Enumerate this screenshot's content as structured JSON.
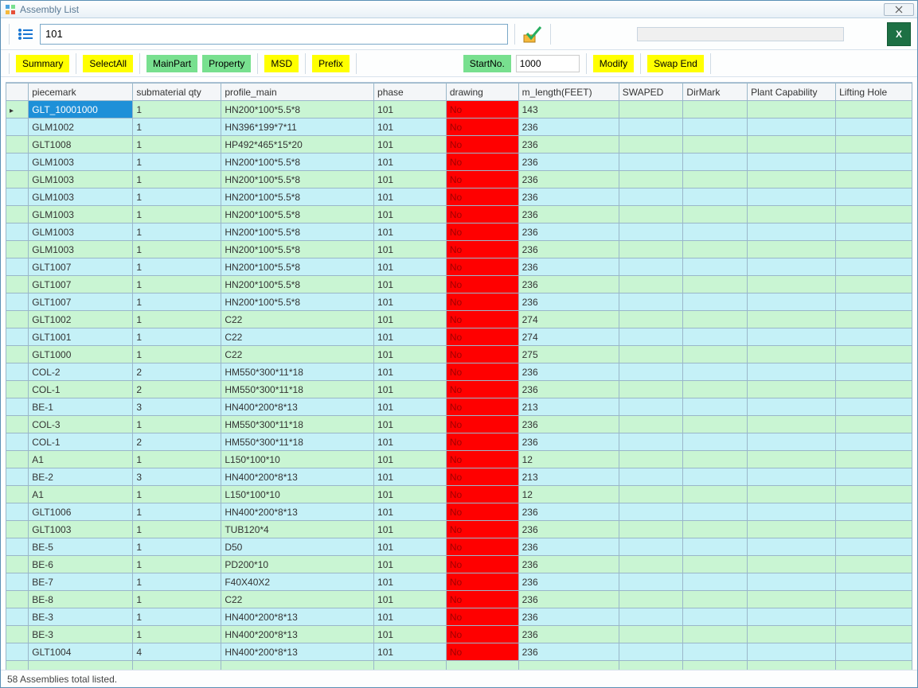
{
  "window": {
    "title": "Assembly List"
  },
  "toolbar1": {
    "search_value": "101",
    "progress_value": ""
  },
  "toolbar2": {
    "summary": "Summary",
    "selectall": "SelectAll",
    "mainpart": "MainPart",
    "property": "Property",
    "msd": "MSD",
    "prefix": "Prefix",
    "startno_label": "StartNo.",
    "startno_value": "1000",
    "modify": "Modify",
    "swapend": "Swap End"
  },
  "columns": {
    "piecemark": "piecemark",
    "submaterial_qty": "submaterial qty",
    "profile_main": "profile_main",
    "phase": "phase",
    "drawing": "drawing",
    "m_length": "m_length(FEET)",
    "swaped": "SWAPED",
    "dirmark": "DirMark",
    "plant_capability": "Plant Capability",
    "lifting_hole": "Lifting Hole"
  },
  "colwidths": {
    "rowhdr": 28,
    "piecemark": 130,
    "submaterial_qty": 110,
    "profile_main": 190,
    "phase": 90,
    "drawing": 90,
    "m_length": 125,
    "swaped": 80,
    "dirmark": 80,
    "plant_capability": 110,
    "lifting_hole": 95
  },
  "rows": [
    {
      "piecemark": "GLT_10001000",
      "qty": "1",
      "profile": "HN200*100*5.5*8",
      "phase": "101",
      "drawing": "No",
      "mlen": "143",
      "selected": true
    },
    {
      "piecemark": "GLM1002",
      "qty": "1",
      "profile": "HN396*199*7*11",
      "phase": "101",
      "drawing": "No",
      "mlen": "236"
    },
    {
      "piecemark": "GLT1008",
      "qty": "1",
      "profile": "HP492*465*15*20",
      "phase": "101",
      "drawing": "No",
      "mlen": "236"
    },
    {
      "piecemark": "GLM1003",
      "qty": "1",
      "profile": "HN200*100*5.5*8",
      "phase": "101",
      "drawing": "No",
      "mlen": "236"
    },
    {
      "piecemark": "GLM1003",
      "qty": "1",
      "profile": "HN200*100*5.5*8",
      "phase": "101",
      "drawing": "No",
      "mlen": "236"
    },
    {
      "piecemark": "GLM1003",
      "qty": "1",
      "profile": "HN200*100*5.5*8",
      "phase": "101",
      "drawing": "No",
      "mlen": "236"
    },
    {
      "piecemark": "GLM1003",
      "qty": "1",
      "profile": "HN200*100*5.5*8",
      "phase": "101",
      "drawing": "No",
      "mlen": "236"
    },
    {
      "piecemark": "GLM1003",
      "qty": "1",
      "profile": "HN200*100*5.5*8",
      "phase": "101",
      "drawing": "No",
      "mlen": "236"
    },
    {
      "piecemark": "GLM1003",
      "qty": "1",
      "profile": "HN200*100*5.5*8",
      "phase": "101",
      "drawing": "No",
      "mlen": "236"
    },
    {
      "piecemark": "GLT1007",
      "qty": "1",
      "profile": "HN200*100*5.5*8",
      "phase": "101",
      "drawing": "No",
      "mlen": "236"
    },
    {
      "piecemark": "GLT1007",
      "qty": "1",
      "profile": "HN200*100*5.5*8",
      "phase": "101",
      "drawing": "No",
      "mlen": "236"
    },
    {
      "piecemark": "GLT1007",
      "qty": "1",
      "profile": "HN200*100*5.5*8",
      "phase": "101",
      "drawing": "No",
      "mlen": "236"
    },
    {
      "piecemark": "GLT1002",
      "qty": "1",
      "profile": "C22",
      "phase": "101",
      "drawing": "No",
      "mlen": "274"
    },
    {
      "piecemark": "GLT1001",
      "qty": "1",
      "profile": "C22",
      "phase": "101",
      "drawing": "No",
      "mlen": "274"
    },
    {
      "piecemark": "GLT1000",
      "qty": "1",
      "profile": "C22",
      "phase": "101",
      "drawing": "No",
      "mlen": "275"
    },
    {
      "piecemark": "COL-2",
      "qty": "2",
      "profile": "HM550*300*11*18",
      "phase": "101",
      "drawing": "No",
      "mlen": "236"
    },
    {
      "piecemark": "COL-1",
      "qty": "2",
      "profile": "HM550*300*11*18",
      "phase": "101",
      "drawing": "No",
      "mlen": "236"
    },
    {
      "piecemark": "BE-1",
      "qty": "3",
      "profile": "HN400*200*8*13",
      "phase": "101",
      "drawing": "No",
      "mlen": "213"
    },
    {
      "piecemark": "COL-3",
      "qty": "1",
      "profile": "HM550*300*11*18",
      "phase": "101",
      "drawing": "No",
      "mlen": "236"
    },
    {
      "piecemark": "COL-1",
      "qty": "2",
      "profile": "HM550*300*11*18",
      "phase": "101",
      "drawing": "No",
      "mlen": "236"
    },
    {
      "piecemark": "A1",
      "qty": "1",
      "profile": "L150*100*10",
      "phase": "101",
      "drawing": "No",
      "mlen": "12"
    },
    {
      "piecemark": "BE-2",
      "qty": "3",
      "profile": "HN400*200*8*13",
      "phase": "101",
      "drawing": "No",
      "mlen": "213"
    },
    {
      "piecemark": "A1",
      "qty": "1",
      "profile": "L150*100*10",
      "phase": "101",
      "drawing": "No",
      "mlen": "12"
    },
    {
      "piecemark": "GLT1006",
      "qty": "1",
      "profile": "HN400*200*8*13",
      "phase": "101",
      "drawing": "No",
      "mlen": "236"
    },
    {
      "piecemark": "GLT1003",
      "qty": "1",
      "profile": "TUB120*4",
      "phase": "101",
      "drawing": "No",
      "mlen": "236"
    },
    {
      "piecemark": "BE-5",
      "qty": "1",
      "profile": "D50",
      "phase": "101",
      "drawing": "No",
      "mlen": "236"
    },
    {
      "piecemark": "BE-6",
      "qty": "1",
      "profile": "PD200*10",
      "phase": "101",
      "drawing": "No",
      "mlen": "236"
    },
    {
      "piecemark": "BE-7",
      "qty": "1",
      "profile": "F40X40X2",
      "phase": "101",
      "drawing": "No",
      "mlen": "236"
    },
    {
      "piecemark": "BE-8",
      "qty": "1",
      "profile": "C22",
      "phase": "101",
      "drawing": "No",
      "mlen": "236"
    },
    {
      "piecemark": "BE-3",
      "qty": "1",
      "profile": "HN400*200*8*13",
      "phase": "101",
      "drawing": "No",
      "mlen": "236"
    },
    {
      "piecemark": "BE-3",
      "qty": "1",
      "profile": "HN400*200*8*13",
      "phase": "101",
      "drawing": "No",
      "mlen": "236"
    },
    {
      "piecemark": "GLT1004",
      "qty": "4",
      "profile": "HN400*200*8*13",
      "phase": "101",
      "drawing": "No",
      "mlen": "236"
    }
  ],
  "statusbar": {
    "text": "58 Assemblies total listed."
  }
}
